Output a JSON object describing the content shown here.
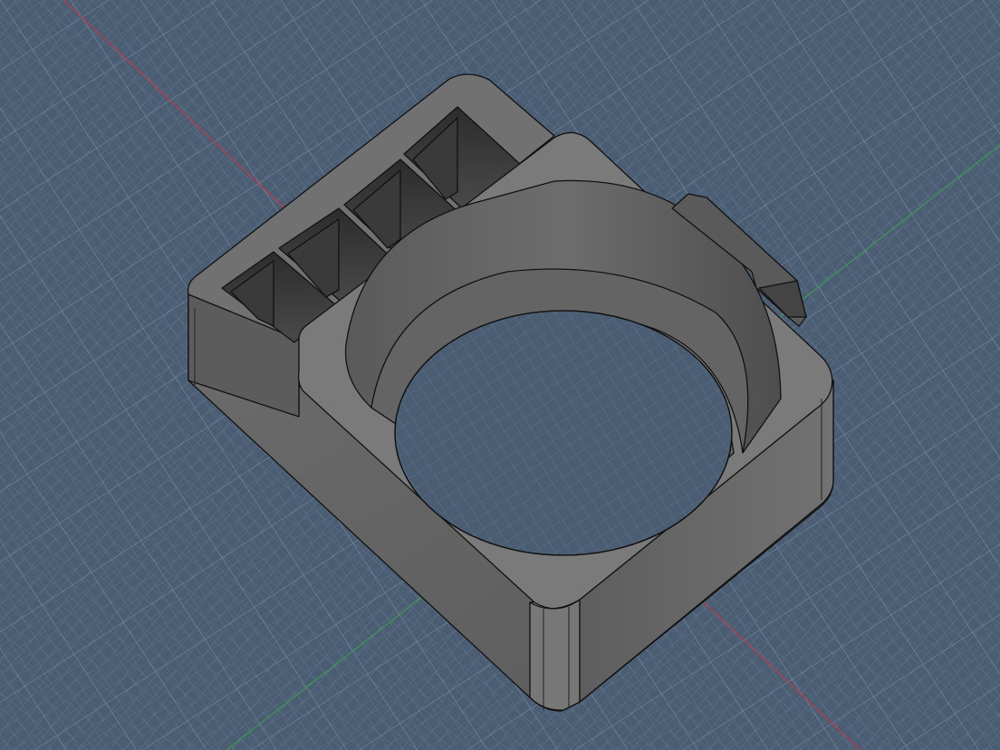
{
  "viewport": {
    "background_color": "#4a5d73",
    "grid_minor_color": "#6e8196",
    "grid_major_color": "#8ea1b5",
    "axis_x_color": "#c0394a",
    "axis_y_color": "#3f9a4e",
    "origin_marker_icon": "origin-crosshair-icon"
  },
  "model": {
    "body_color": "#6a6a6a",
    "top_face_color": "#747474",
    "shadow_color": "#3a3a3a",
    "edge_color": "#111111",
    "compartment_count": 4
  }
}
